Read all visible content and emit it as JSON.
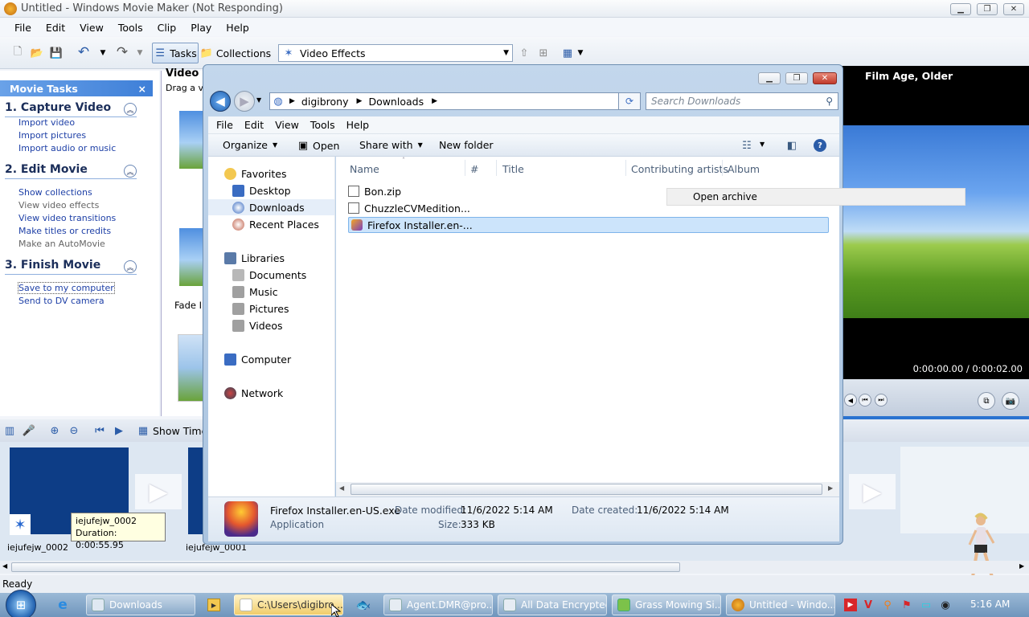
{
  "app": {
    "title": "Untitled - Windows Movie Maker (Not Responding)"
  },
  "menu": [
    "File",
    "Edit",
    "View",
    "Tools",
    "Clip",
    "Play",
    "Help"
  ],
  "toolbar": {
    "tasks_label": "Tasks",
    "collections_label": "Collections",
    "effects_dropdown": "Video Effects"
  },
  "tasks_pane": {
    "header": "Movie Tasks",
    "close_glyph": "×",
    "sections": [
      {
        "title": "1. Capture Video",
        "links": [
          {
            "label": "Import video",
            "enabled": true
          },
          {
            "label": "Import pictures",
            "enabled": true
          },
          {
            "label": "Import audio or music",
            "enabled": true
          }
        ]
      },
      {
        "title": "2. Edit Movie",
        "links": [
          {
            "label": "Show collections",
            "enabled": true
          },
          {
            "label": "View video effects",
            "enabled": false
          },
          {
            "label": "View video transitions",
            "enabled": true
          },
          {
            "label": "Make titles or credits",
            "enabled": true
          },
          {
            "label": "Make an AutoMovie",
            "enabled": false
          }
        ]
      },
      {
        "title": "3. Finish Movie",
        "links": [
          {
            "label": "Save to my computer",
            "enabled": true
          },
          {
            "label": "Send to DV camera",
            "enabled": true
          }
        ]
      }
    ]
  },
  "collections_pane": {
    "title": "Video",
    "hint": "Drag a vi",
    "item_label": "Fade I"
  },
  "preview": {
    "effect_name": "Film Age, Older",
    "time": "0:00:00.00 / 0:00:02.00"
  },
  "timeline": {
    "show_timeline_label": "Show Time",
    "clips": [
      {
        "name": "iejufejw_0002"
      },
      {
        "name": "iejufejw_0001"
      }
    ],
    "tooltip": {
      "name": "iejufejw_0002",
      "duration": "Duration:  0:00:55.95"
    }
  },
  "status_bar": {
    "text": "Ready"
  },
  "explorer": {
    "breadcrumb": [
      "digibrony",
      "Downloads"
    ],
    "search_placeholder": "Search Downloads",
    "menu": [
      "File",
      "Edit",
      "View",
      "Tools",
      "Help"
    ],
    "commands": {
      "organize": "Organize",
      "open": "Open",
      "share": "Share with",
      "new_folder": "New folder"
    },
    "nav": {
      "favorites": "Favorites",
      "desktop": "Desktop",
      "downloads": "Downloads",
      "recent": "Recent Places",
      "libraries": "Libraries",
      "documents": "Documents",
      "music": "Music",
      "pictures": "Pictures",
      "videos": "Videos",
      "computer": "Computer",
      "network": "Network"
    },
    "columns": [
      "Name",
      "#",
      "Title",
      "Contributing artists",
      "Album"
    ],
    "files": [
      {
        "name": "Bon.zip",
        "selected": false
      },
      {
        "name": "ChuzzleCVMedition...",
        "selected": false
      },
      {
        "name": "Firefox Installer.en-...",
        "selected": true
      }
    ],
    "context_item": "Open archive",
    "details": {
      "file_name": "Firefox Installer.en-US.exe",
      "type": "Application",
      "modified_label": "Date modified:",
      "modified_value": "11/6/2022 5:14 AM",
      "size_label": "Size:",
      "size_value": "333 KB",
      "created_label": "Date created:",
      "created_value": "11/6/2022 5:14 AM"
    }
  },
  "taskbar": {
    "items": [
      {
        "label": "Downloads",
        "active": false
      },
      {
        "label": "C:\\Users\\digibro...",
        "active": true
      },
      {
        "label": "Agent.DMR@pro...",
        "active": false
      },
      {
        "label": "All Data Encrypted",
        "active": false
      },
      {
        "label": "Grass Mowing Si...",
        "active": false
      },
      {
        "label": "Untitled - Windo...",
        "active": false
      }
    ],
    "clock": "5:16 AM"
  }
}
